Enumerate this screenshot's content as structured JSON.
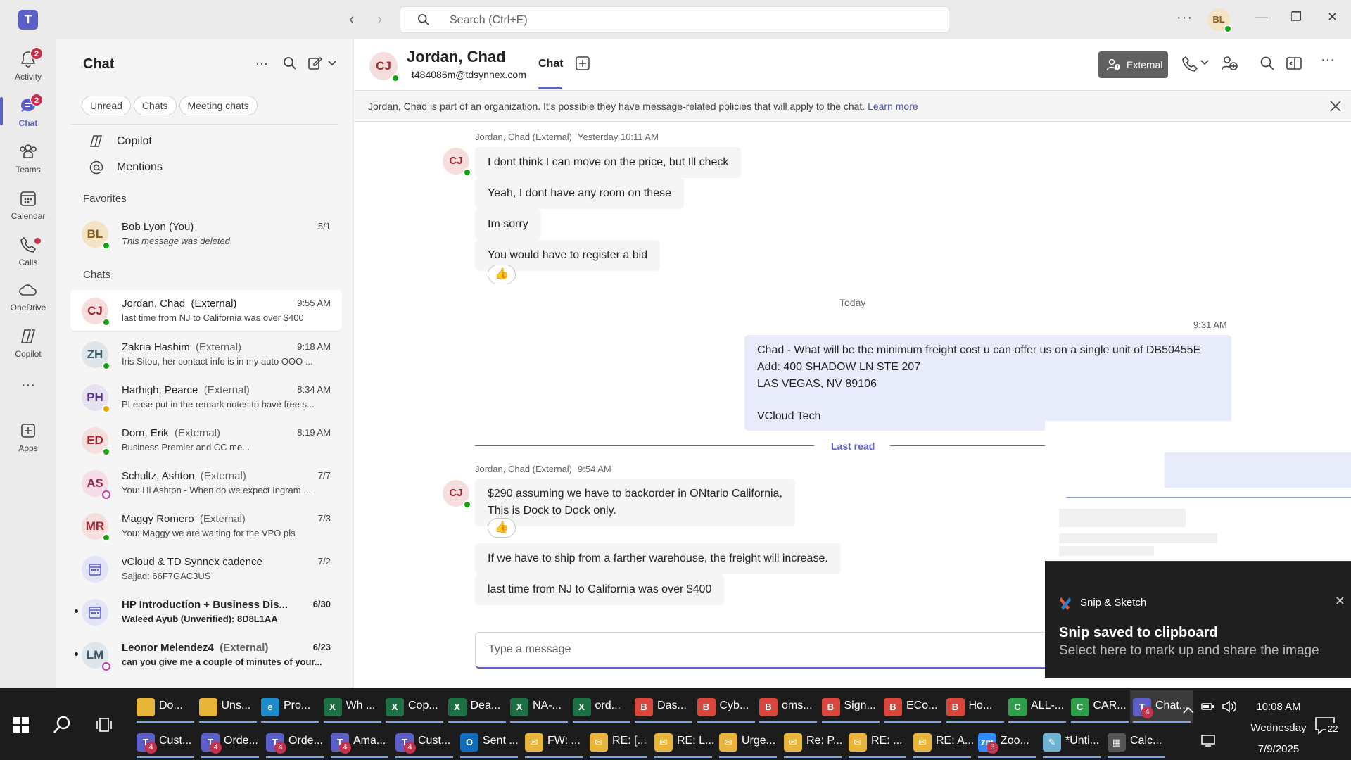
{
  "titlebar": {
    "logo": "T",
    "search_placeholder": "Search (Ctrl+E)",
    "back_glyph": "‹",
    "forward_glyph": "›",
    "more_glyph": "···",
    "user_initials": "BL",
    "minimize_glyph": "—",
    "maximize_glyph": "❐",
    "close_glyph": "✕"
  },
  "rail": {
    "items": [
      {
        "label": "Activity",
        "icon": "bell-icon",
        "badge": "2"
      },
      {
        "label": "Chat",
        "icon": "chat-icon",
        "badge": "2"
      },
      {
        "label": "Teams",
        "icon": "teams-icon"
      },
      {
        "label": "Calendar",
        "icon": "calendar-icon"
      },
      {
        "label": "Calls",
        "icon": "phone-icon"
      },
      {
        "label": "OneDrive",
        "icon": "cloud-icon"
      },
      {
        "label": "Copilot",
        "icon": "copilot-icon"
      },
      {
        "label": "Apps",
        "icon": "apps-icon"
      }
    ],
    "more_glyph": "···"
  },
  "chat_list": {
    "title": "Chat",
    "more_glyph": "···",
    "filters": [
      "Unread",
      "Chats",
      "Meeting chats"
    ],
    "copilot_label": "Copilot",
    "mentions_label": "Mentions",
    "favorites_label": "Favorites",
    "chats_label": "Chats",
    "favorites": [
      {
        "initials": "BL",
        "name": "Bob Lyon (You)",
        "ext": "",
        "time": "5/1",
        "preview": "This message was deleted"
      }
    ],
    "chats": [
      {
        "initials": "CJ",
        "name": "Jordan, Chad",
        "ext": "(External)",
        "time": "9:55 AM",
        "preview": "last time from NJ to California was over $400"
      },
      {
        "initials": "ZH",
        "name": "Zakria Hashim",
        "ext": "(External)",
        "time": "9:18 AM",
        "preview": "Iris Sitou, her contact info is in my auto OOO ..."
      },
      {
        "initials": "PH",
        "name": "Harhigh, Pearce",
        "ext": "(External)",
        "time": "8:34 AM",
        "preview": "PLease put in the remark notes to have free s..."
      },
      {
        "initials": "ED",
        "name": "Dorn, Erik",
        "ext": "(External)",
        "time": "8:19 AM",
        "preview": "Business Premier and CC me..."
      },
      {
        "initials": "AS",
        "name": "Schultz, Ashton",
        "ext": "(External)",
        "time": "7/7",
        "preview": "You: Hi Ashton -  When do we expect Ingram ..."
      },
      {
        "initials": "MR",
        "name": "Maggy Romero",
        "ext": "(External)",
        "time": "7/3",
        "preview": "You: Maggy we are waiting for the VPO pls"
      },
      {
        "initials": "",
        "name": "vCloud & TD Synnex cadence",
        "ext": "",
        "time": "7/2",
        "preview": "Sajjad: 66F7GAC3US"
      },
      {
        "initials": "",
        "name": "HP Introduction + Business Dis...",
        "ext": "",
        "time": "6/30",
        "preview": "Waleed Ayub (Unverified): 8D8L1AA"
      },
      {
        "initials": "LM",
        "name": "Leonor Melendez4",
        "ext": "(External)",
        "time": "6/23",
        "preview": "can you give me a couple of minutes of your..."
      }
    ]
  },
  "conversation": {
    "avatar_initials": "CJ",
    "name": "Jordan, Chad",
    "email": "t484086m@tdsynnex.com",
    "tab_label": "Chat",
    "external_label": "External",
    "banner_text": "Jordan, Chad is part of an organization. It's possible they have message-related policies that will apply to the chat.",
    "banner_link": "Learn more",
    "group1_sender": "Jordan, Chad (External)",
    "group1_time": "Yesterday 10:11 AM",
    "group1_messages": [
      "I dont think I can move on the price, but Ill check",
      "Yeah, I dont have any room on these",
      "Im sorry",
      "You would have to register a bid"
    ],
    "reaction_emoji": "👍",
    "day_separator": "Today",
    "my_time": "9:31 AM",
    "my_message_lines": [
      "Chad -  What will be the minimum freight cost u can offer us on a single unit of DB50455E",
      "Add: 400 SHADOW LN STE 207",
      "LAS VEGAS, NV 89106",
      "",
      "VCloud Tech"
    ],
    "last_read_label": "Last read",
    "group2_sender": "Jordan, Chad (External)",
    "group2_time": "9:54 AM",
    "group2_first_lines": [
      "$290 assuming we have to backorder in ONtario California,",
      "This is Dock to Dock only."
    ],
    "group2_messages": [
      "If we have to ship from a farther warehouse, the freight will increase.",
      "last time from NJ to California was over $400"
    ],
    "composer_placeholder": "Type a message"
  },
  "toast": {
    "app_name": "Snip & Sketch",
    "title": "Snip saved to clipboard",
    "subtitle": "Select here to mark up and share the image",
    "close_glyph": "✕"
  },
  "taskbar": {
    "row1": [
      {
        "label": "Do...",
        "icon": "folder-icon",
        "color": "#e8b43a",
        "glyph": ""
      },
      {
        "label": "Uns...",
        "icon": "folder-icon",
        "color": "#e8b43a",
        "glyph": ""
      },
      {
        "label": "Pro...",
        "icon": "edge-icon",
        "color": "#1f8ac9",
        "glyph": "e"
      },
      {
        "label": "Wh ...",
        "icon": "excel-icon",
        "color": "#1d7044",
        "glyph": "X"
      },
      {
        "label": "Cop...",
        "icon": "excel-icon",
        "color": "#1d7044",
        "glyph": "X"
      },
      {
        "label": "Dea...",
        "icon": "excel-icon",
        "color": "#1d7044",
        "glyph": "X"
      },
      {
        "label": "NA-...",
        "icon": "excel-icon",
        "color": "#1d7044",
        "glyph": "X"
      },
      {
        "label": "ord...",
        "icon": "excel-icon",
        "color": "#1d7044",
        "glyph": "X"
      },
      {
        "label": "Das...",
        "icon": "chrome-icon",
        "color": "#d9473c",
        "glyph": "B"
      },
      {
        "label": "Cyb...",
        "icon": "chrome-icon",
        "color": "#d9473c",
        "glyph": "B"
      },
      {
        "label": "oms...",
        "icon": "chrome-icon",
        "color": "#d9473c",
        "glyph": "B"
      },
      {
        "label": "Sign...",
        "icon": "chrome-icon",
        "color": "#d9473c",
        "glyph": "B"
      },
      {
        "label": "ECo...",
        "icon": "chrome-icon",
        "color": "#d9473c",
        "glyph": "B"
      },
      {
        "label": "Ho...",
        "icon": "chrome-icon",
        "color": "#d9473c",
        "glyph": "B"
      },
      {
        "label": "ALL-...",
        "icon": "chrome-icon",
        "color": "#2f9e4a",
        "glyph": "C"
      },
      {
        "label": "CAR...",
        "icon": "chrome-icon",
        "color": "#2f9e4a",
        "glyph": "C"
      },
      {
        "label": "Chat...",
        "icon": "teams-icon",
        "color": "#5b5fc7",
        "glyph": "T",
        "count": "4"
      }
    ],
    "row2": [
      {
        "label": "Cust...",
        "icon": "teams-icon",
        "color": "#5b5fc7",
        "glyph": "T",
        "count": "4"
      },
      {
        "label": "Orde...",
        "icon": "teams-icon",
        "color": "#5b5fc7",
        "glyph": "T",
        "count": "4"
      },
      {
        "label": "Orde...",
        "icon": "teams-icon",
        "color": "#5b5fc7",
        "glyph": "T",
        "count": "4"
      },
      {
        "label": "Ama...",
        "icon": "teams-icon",
        "color": "#5b5fc7",
        "glyph": "T",
        "count": "4"
      },
      {
        "label": "Cust...",
        "icon": "teams-icon",
        "color": "#5b5fc7",
        "glyph": "T",
        "count": "4"
      },
      {
        "label": "Sent ...",
        "icon": "outlook-icon",
        "color": "#0f6cbd",
        "glyph": "O"
      },
      {
        "label": "FW: ...",
        "icon": "mail-icon",
        "color": "#e8b43a",
        "glyph": "✉"
      },
      {
        "label": "RE: [...",
        "icon": "mail-icon",
        "color": "#e8b43a",
        "glyph": "✉"
      },
      {
        "label": "RE: L...",
        "icon": "mail-icon",
        "color": "#e8b43a",
        "glyph": "✉"
      },
      {
        "label": "Urge...",
        "icon": "mail-icon",
        "color": "#e8b43a",
        "glyph": "✉"
      },
      {
        "label": "Re: P...",
        "icon": "mail-icon",
        "color": "#e8b43a",
        "glyph": "✉"
      },
      {
        "label": "RE: ...",
        "icon": "mail-icon",
        "color": "#e8b43a",
        "glyph": "✉"
      },
      {
        "label": "RE: A...",
        "icon": "mail-icon",
        "color": "#e8b43a",
        "glyph": "✉"
      },
      {
        "label": "Zoo...",
        "icon": "zoom-icon",
        "color": "#2d8cff",
        "glyph": "zm",
        "count": "3"
      },
      {
        "label": "*Unti...",
        "icon": "notepad-icon",
        "color": "#6fb3d2",
        "glyph": "✎"
      },
      {
        "label": "Calc...",
        "icon": "calculator-icon",
        "color": "#555555",
        "glyph": "▦"
      }
    ],
    "clock_time": "10:08 AM",
    "clock_day": "Wednesday",
    "clock_date": "7/9/2025",
    "notification_count": "22",
    "tray_up_glyph": "^"
  }
}
